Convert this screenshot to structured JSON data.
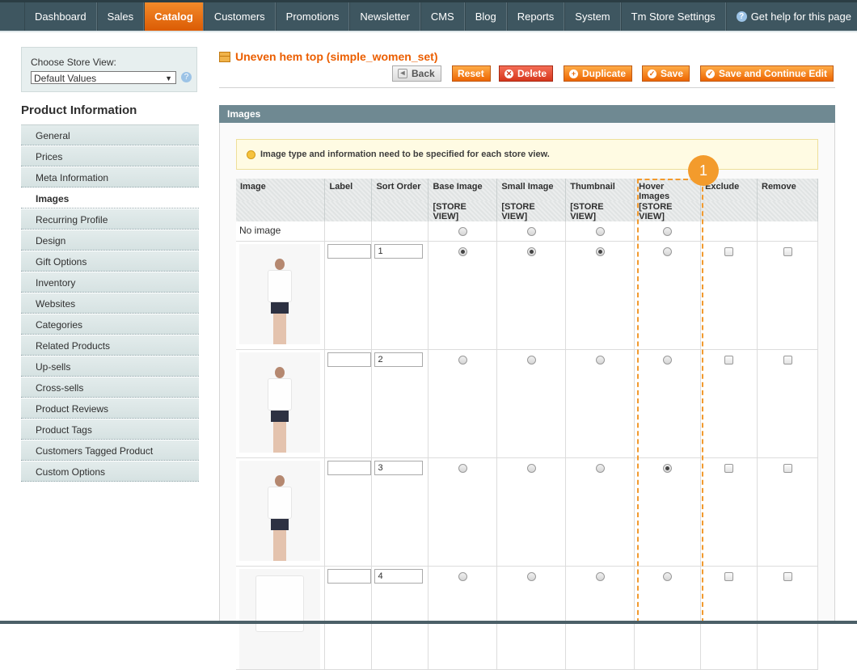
{
  "nav": [
    "Dashboard",
    "Sales",
    "Catalog",
    "Customers",
    "Promotions",
    "Newsletter",
    "CMS",
    "Blog",
    "Reports",
    "System",
    "Tm Store Settings"
  ],
  "nav_help": "Get help for this page",
  "store_view": {
    "label": "Choose Store View:",
    "value": "Default Values"
  },
  "product_info_title": "Product Information",
  "tabs": [
    "General",
    "Prices",
    "Meta Information",
    "Images",
    "Recurring Profile",
    "Design",
    "Gift Options",
    "Inventory",
    "Websites",
    "Categories",
    "Related Products",
    "Up-sells",
    "Cross-sells",
    "Product Reviews",
    "Product Tags",
    "Customers Tagged Product",
    "Custom Options"
  ],
  "active_tab": "Images",
  "product_title": "Uneven hem top (simple_women_set)",
  "buttons": {
    "back": "Back",
    "reset": "Reset",
    "delete": "Delete",
    "duplicate": "Duplicate",
    "save": "Save",
    "save_continue": "Save and Continue Edit"
  },
  "section_title": "Images",
  "notice": "Image type and information need to be specified for each store view.",
  "columns": [
    "Image",
    "Label",
    "Sort Order",
    "Base Image",
    "Small Image",
    "Thumbnail",
    "Hover Images",
    "Exclude",
    "Remove"
  ],
  "store_view_tag": "[STORE VIEW]",
  "no_image": "No image",
  "rows": [
    {
      "label": "",
      "sort": "1",
      "base": true,
      "small": true,
      "thumb": true,
      "hover": false
    },
    {
      "label": "",
      "sort": "2",
      "base": false,
      "small": false,
      "thumb": false,
      "hover": false
    },
    {
      "label": "",
      "sort": "3",
      "base": false,
      "small": false,
      "thumb": false,
      "hover": true
    },
    {
      "label": "",
      "sort": "4",
      "base": false,
      "small": false,
      "thumb": false,
      "hover": false
    }
  ],
  "callout_number": "1"
}
